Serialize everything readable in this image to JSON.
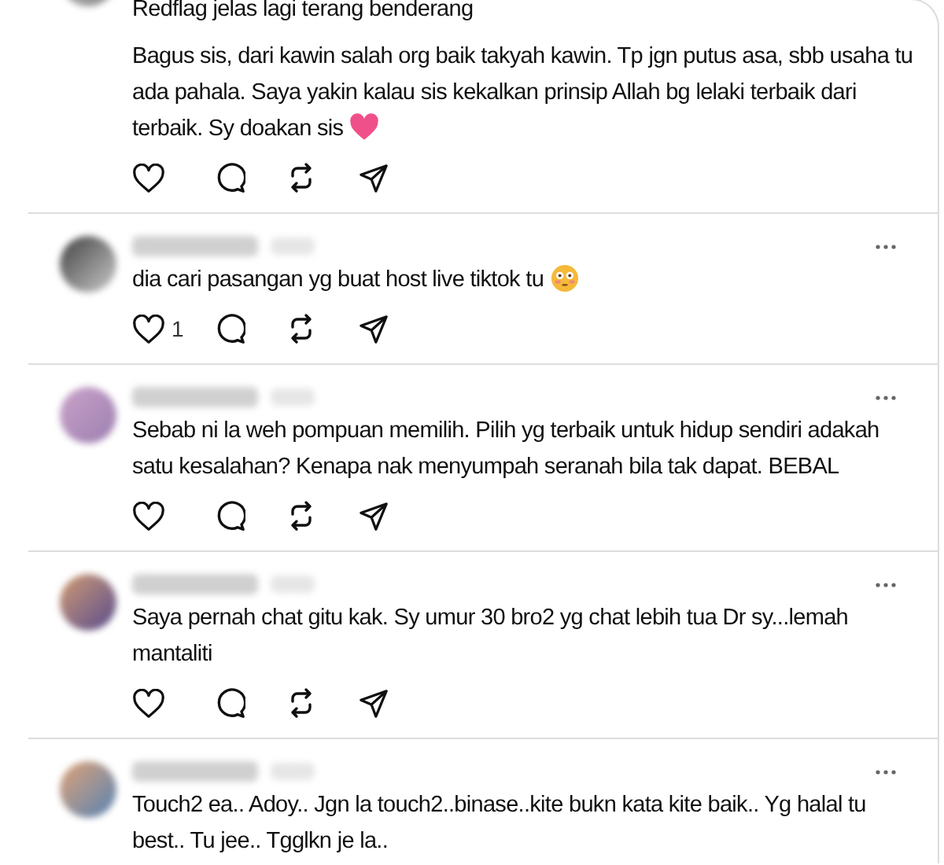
{
  "comments": [
    {
      "header": false,
      "paragraphs": [
        "Redflag jelas lagi terang benderang",
        "Bagus sis, dari kawin salah org baik takyah kawin. Tp jgn putus asa, sbb usaha tu ada pahala. Saya yakin kalau sis kekalkan prinsip Allah bg lelaki terbaik dari terbaik. Sy doakan sis"
      ],
      "heart_emoji": true
    },
    {
      "header": true,
      "paragraphs": [
        "dia cari pasangan yg buat host live tiktok tu"
      ],
      "flushed_emoji": true,
      "likes": "1"
    },
    {
      "header": true,
      "paragraphs": [
        "Sebab ni la weh pompuan memilih. Pilih yg terbaik untuk hidup sendiri adakah satu kesalahan? Kenapa nak menyumpah seranah bila tak dapat. BEBAL"
      ]
    },
    {
      "header": true,
      "paragraphs": [
        "Saya pernah chat gitu kak. Sy umur 30 bro2 yg chat lebih tua Dr sy...lemah mantaliti"
      ]
    },
    {
      "header": true,
      "paragraphs": [
        "Touch2 ea.. Adoy.. Jgn la touch2..binase..kite bukn kata kite baik.. Yg halal tu best.. Tu jee.. Tgglkn je la.."
      ],
      "actions": false
    }
  ]
}
